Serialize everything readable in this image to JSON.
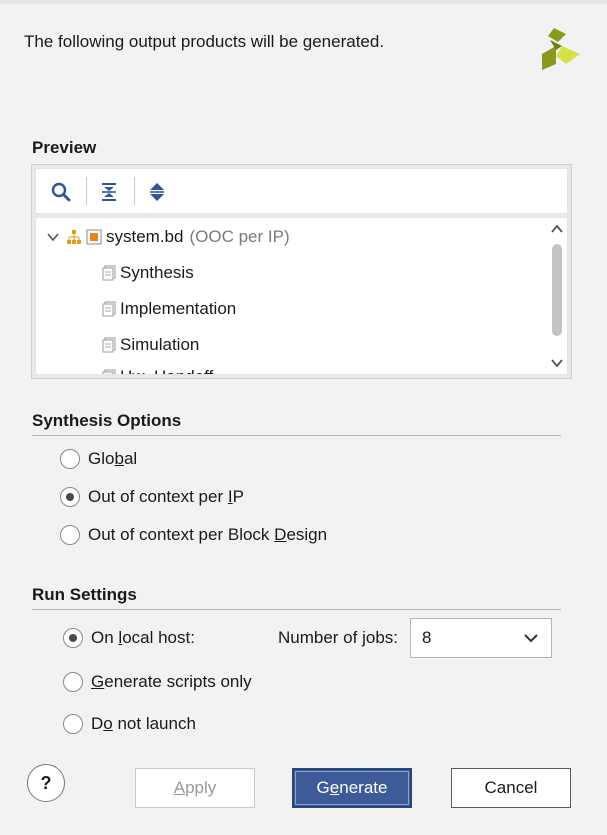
{
  "header": {
    "message": "The following output products will be generated."
  },
  "preview": {
    "title": "Preview",
    "toolbar": {
      "search_icon": "search-icon",
      "collapse_all_icon": "collapse-all-icon",
      "expand_all_icon": "expand-all-icon"
    },
    "tree": {
      "root": {
        "name": "system.bd",
        "note": "(OOC per IP)"
      },
      "children": [
        {
          "label": "Synthesis"
        },
        {
          "label": "Implementation"
        },
        {
          "label": "Simulation"
        },
        {
          "label": "Hw_Handoff"
        }
      ]
    }
  },
  "synthesis_options": {
    "title": "Synthesis Options",
    "options": [
      {
        "pre": "Glo",
        "u": "b",
        "post": "al",
        "checked": false
      },
      {
        "pre": "Out of context per ",
        "u": "I",
        "post": "P",
        "checked": true
      },
      {
        "pre": "Out of context per Block ",
        "u": "D",
        "post": "esign",
        "checked": false
      }
    ]
  },
  "run_settings": {
    "title": "Run Settings",
    "options": [
      {
        "pre": "On ",
        "u": "l",
        "post": "ocal host:",
        "checked": true
      },
      {
        "pre": "",
        "u": "G",
        "post": "enerate scripts only",
        "checked": false
      },
      {
        "pre": "D",
        "u": "o",
        "post": " not launch",
        "checked": false
      }
    ],
    "jobs_label": "Number of jobs:",
    "jobs_value": "8"
  },
  "buttons": {
    "help": "?",
    "apply": {
      "u": "A",
      "post": "pply"
    },
    "generate": {
      "pre": "G",
      "u": "e",
      "post": "nerate"
    },
    "cancel": "Cancel"
  },
  "colors": {
    "accent": "#3d5a99",
    "logo_dark": "#8a9a1e",
    "logo_light": "#d6e04a",
    "hierarchy_icon": "#e69a1a",
    "bd_icon": "#e8841a"
  }
}
